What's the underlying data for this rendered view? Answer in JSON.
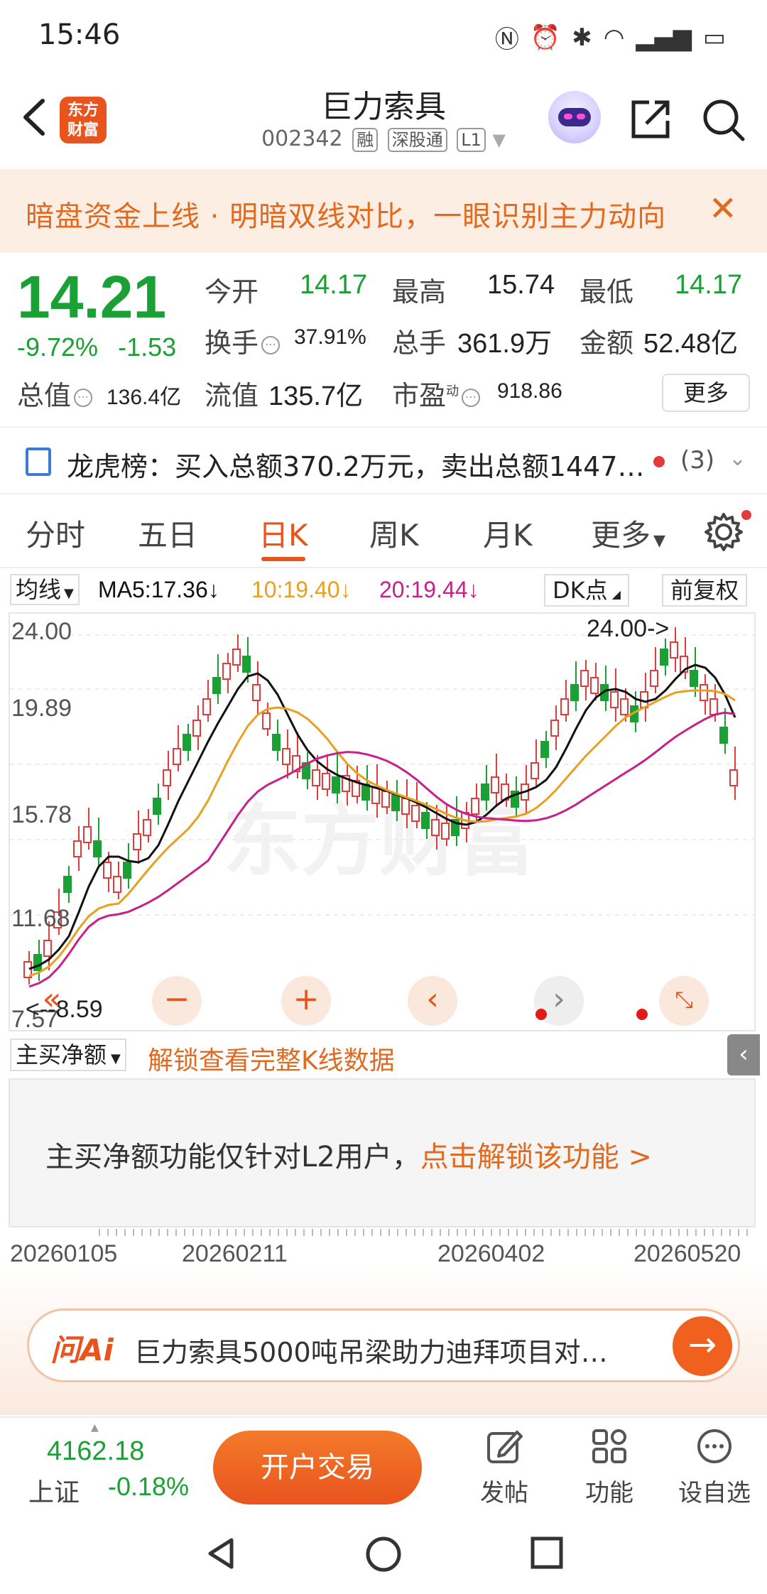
{
  "status": {
    "time": "15:46"
  },
  "header": {
    "logo_line1": "东方",
    "logo_line2": "财富",
    "stock_name": "巨力索具",
    "stock_code": "002342",
    "tag_margin": "融",
    "tag_connect": "深股通",
    "tag_level": "L1"
  },
  "banner": {
    "text": "暗盘资金上线 · 明暗双线对比，一眼识别主力动向"
  },
  "quote": {
    "price": "14.21",
    "change_pct": "-9.72%",
    "change_abs": "-1.53",
    "open_label": "今开",
    "open": "14.17",
    "high_label": "最高",
    "high": "15.74",
    "low_label": "最低",
    "low": "14.17",
    "turnover_label": "换手",
    "turnover": "37.91%",
    "volume_label": "总手",
    "volume": "361.9万",
    "amount_label": "金额",
    "amount": "52.48亿",
    "mktcap_label": "总值",
    "mktcap": "136.4亿",
    "float_label": "流值",
    "float": "135.7亿",
    "pe_label": "市盈",
    "pe_sup": "动",
    "pe": "918.86",
    "more": "更多"
  },
  "lhb": {
    "text": "龙虎榜：买入总额370.2万元，卖出总额1447…",
    "count": "(3)"
  },
  "tabs": [
    "分时",
    "五日",
    "日K",
    "周K",
    "月K",
    "更多"
  ],
  "ma": {
    "select": "均线",
    "ma5": "MA5:17.36↓",
    "ma10": "10:19.40↓",
    "ma20": "20:19.44↓",
    "dk": "DK点",
    "adjust": "前复权",
    "colors": {
      "ma5": "#111111",
      "ma10": "#e8a020",
      "ma20": "#c8208a",
      "up": "#e23b3b",
      "down": "#1aa034"
    }
  },
  "chart_data": {
    "type": "candlestick",
    "y_ticks": [
      "24.00",
      "19.89",
      "15.78",
      "11.68",
      "7.57"
    ],
    "max_label": "24.00->",
    "min_label": "<--8.59",
    "x_labels": [
      "20260105",
      "20260211",
      "20260402",
      "20260520"
    ],
    "watermark": "东方财富"
  },
  "sub": {
    "select": "主买净额",
    "unlock_link": "解锁查看完整K线数据",
    "lock_text": "主买净额功能仅针对L2用户，",
    "lock_link": "点击解锁该功能 >"
  },
  "ai": {
    "logo": "问Ai",
    "text": "巨力索具5000吨吊梁助力迪拜项目对…"
  },
  "bottom": {
    "index_value": "4162.18",
    "index_name": "上证",
    "index_change": "-0.18%",
    "trade": "开户交易",
    "post": "发帖",
    "function": "功能",
    "watch": "设自选"
  }
}
